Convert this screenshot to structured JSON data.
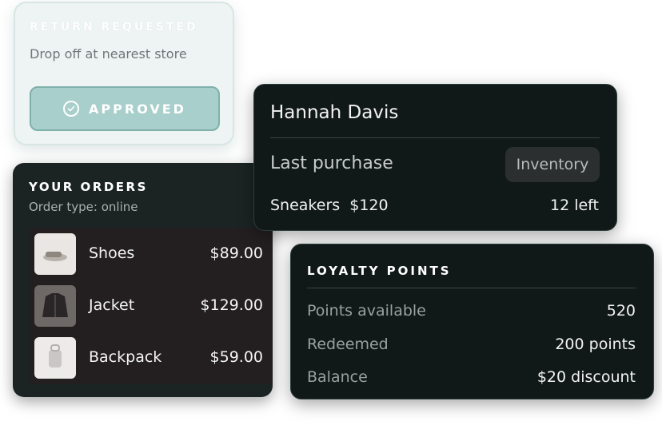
{
  "return_card": {
    "title": "RETURN REQUESTED",
    "subtitle": "Drop off at nearest store",
    "status_button": "APPROVED"
  },
  "orders": {
    "title": "YOUR ORDERS",
    "subtitle": "Order type: online",
    "items": [
      {
        "name": "Shoes",
        "price": "$89.00"
      },
      {
        "name": "Jacket",
        "price": "$129.00"
      },
      {
        "name": "Backpack",
        "price": "$59.00"
      }
    ]
  },
  "customer": {
    "name": "Hannah Davis",
    "section_label": "Last purchase",
    "inventory_button": "Inventory",
    "product": "Sneakers  $120",
    "stock": "12 left"
  },
  "loyalty": {
    "title": "LOYALTY POINTS",
    "rows": [
      {
        "label": "Points available",
        "value": "520"
      },
      {
        "label": "Redeemed",
        "value": "200 points"
      },
      {
        "label": "Balance",
        "value": "$20 discount"
      }
    ]
  },
  "colors": {
    "accent_teal": "#a8cfcb",
    "dark_card": "#111818",
    "orders_card": "#1b2423"
  }
}
